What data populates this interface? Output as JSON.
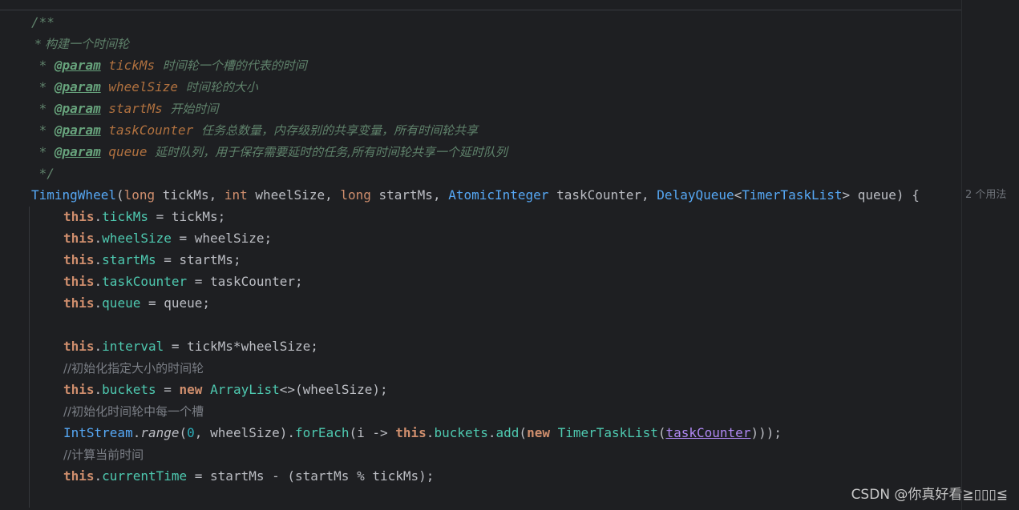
{
  "doc": {
    "open": "/**",
    "summary": " * 构建一个时间轮",
    "star": " * ",
    "tag": "@param",
    "params": [
      {
        "name": "tickMs",
        "desc": "时间轮一个槽的代表的时间"
      },
      {
        "name": "wheelSize",
        "desc": "时间轮的大小"
      },
      {
        "name": "startMs",
        "desc": "开始时间"
      },
      {
        "name": "taskCounter",
        "desc": "任务总数量，内存级别的共享变量，所有时间轮共享"
      },
      {
        "name": "queue",
        "desc": "延时队列，用于保存需要延时的任务,所有时间轮共享一个延时队列"
      }
    ],
    "close": " */"
  },
  "signature": {
    "ctor": "TimingWheel",
    "open_paren": "(",
    "kw_long": "long",
    "p1": " tickMs, ",
    "kw_int": "int",
    "p2": " wheelSize, ",
    "kw_long2": "long",
    "p3": " startMs, ",
    "t_atomic": "AtomicInteger",
    "p4": " taskCounter, ",
    "t_delay": "DelayQueue",
    "lt": "<",
    "t_ttl": "TimerTaskList",
    "gt_rest": "> queue) {"
  },
  "usages_hint": "2 个用法",
  "body": {
    "this": "this",
    "dot": ".",
    "assign_tickMs": {
      "field": "tickMs",
      "rest": " = tickMs;"
    },
    "assign_wheelSize": {
      "field": "wheelSize",
      "rest": " = wheelSize;"
    },
    "assign_startMs": {
      "field": "startMs",
      "rest": " = startMs;"
    },
    "assign_taskCounter": {
      "field": "taskCounter",
      "rest": " = taskCounter;"
    },
    "assign_queue": {
      "field": "queue",
      "rest": " = queue;"
    },
    "assign_interval": {
      "field": "interval",
      "rest": " = tickMs*wheelSize;"
    },
    "comment1": "//初始化指定大小的时间轮",
    "buckets_line": {
      "field": "buckets",
      "mid": " = ",
      "kw_new": "new",
      "sp": " ",
      "type": "ArrayList",
      "rest": "<>(wheelSize);"
    },
    "comment2": "//初始化时间轮中每一个槽",
    "stream_line": {
      "type": "IntStream",
      "dot": ".",
      "range": "range",
      "p_open": "(",
      "zero": "0",
      "after_zero": ", wheelSize).",
      "forEach": "forEach",
      "lambda": "(i -> ",
      "field": "buckets",
      "dot2": ".",
      "add": "add",
      "p_open2": "(",
      "kw_new": "new",
      "sp": " ",
      "ttl": "TimerTaskList",
      "p_open3": "(",
      "ref": "taskCounter",
      "close": ")));"
    },
    "comment3": "//计算当前时间",
    "assign_currentTime": {
      "field": "currentTime",
      "rest": " = startMs - (startMs % tickMs);"
    }
  },
  "watermark": "CSDN @你真好看≧▯▯▯≦"
}
